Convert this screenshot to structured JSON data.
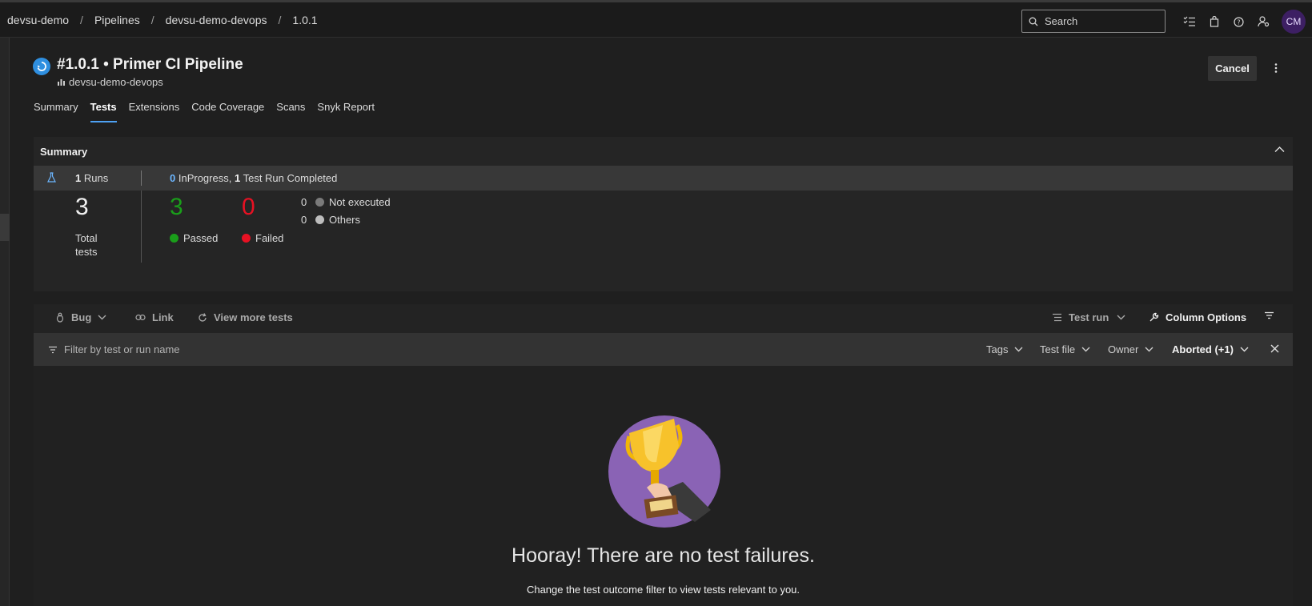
{
  "breadcrumb": {
    "items": [
      "devsu-demo",
      "Pipelines",
      "devsu-demo-devops",
      "1.0.1"
    ],
    "separator": "/"
  },
  "search": {
    "placeholder": "Search"
  },
  "user": {
    "initials": "CM"
  },
  "header": {
    "title": "#1.0.1 • Primer CI Pipeline",
    "repo": "devsu-demo-devops",
    "cancel_label": "Cancel"
  },
  "tabs": [
    {
      "label": "Summary",
      "active": false
    },
    {
      "label": "Tests",
      "active": true
    },
    {
      "label": "Extensions",
      "active": false
    },
    {
      "label": "Code Coverage",
      "active": false
    },
    {
      "label": "Scans",
      "active": false
    },
    {
      "label": "Snyk Report",
      "active": false
    }
  ],
  "summary": {
    "heading": "Summary",
    "runs_count": "1",
    "runs_label": "Runs",
    "inprogress_count": "0",
    "inprogress_label": "InProgress,",
    "completed_count": "1",
    "completed_label": "Test Run Completed",
    "total": "3",
    "total_label": "Total tests",
    "passed": "3",
    "passed_label": "Passed",
    "failed": "0",
    "failed_label": "Failed",
    "not_executed": "0",
    "not_executed_label": "Not executed",
    "others": "0",
    "others_label": "Others"
  },
  "toolbar": {
    "bug_label": "Bug",
    "link_label": "Link",
    "view_more_label": "View more tests",
    "test_run_label": "Test run",
    "column_options_label": "Column Options"
  },
  "filter": {
    "placeholder": "Filter by test or run name",
    "tags_label": "Tags",
    "test_file_label": "Test file",
    "owner_label": "Owner",
    "outcome_label": "Aborted (+1)"
  },
  "empty_state": {
    "title": "Hooray! There are no test failures.",
    "hint": "Change the test outcome filter to view tests relevant to you."
  },
  "colors": {
    "passed": "#1a9e1a",
    "failed": "#e81123",
    "accent": "#4ea1f3",
    "trophy_bg": "#8a63b5"
  }
}
